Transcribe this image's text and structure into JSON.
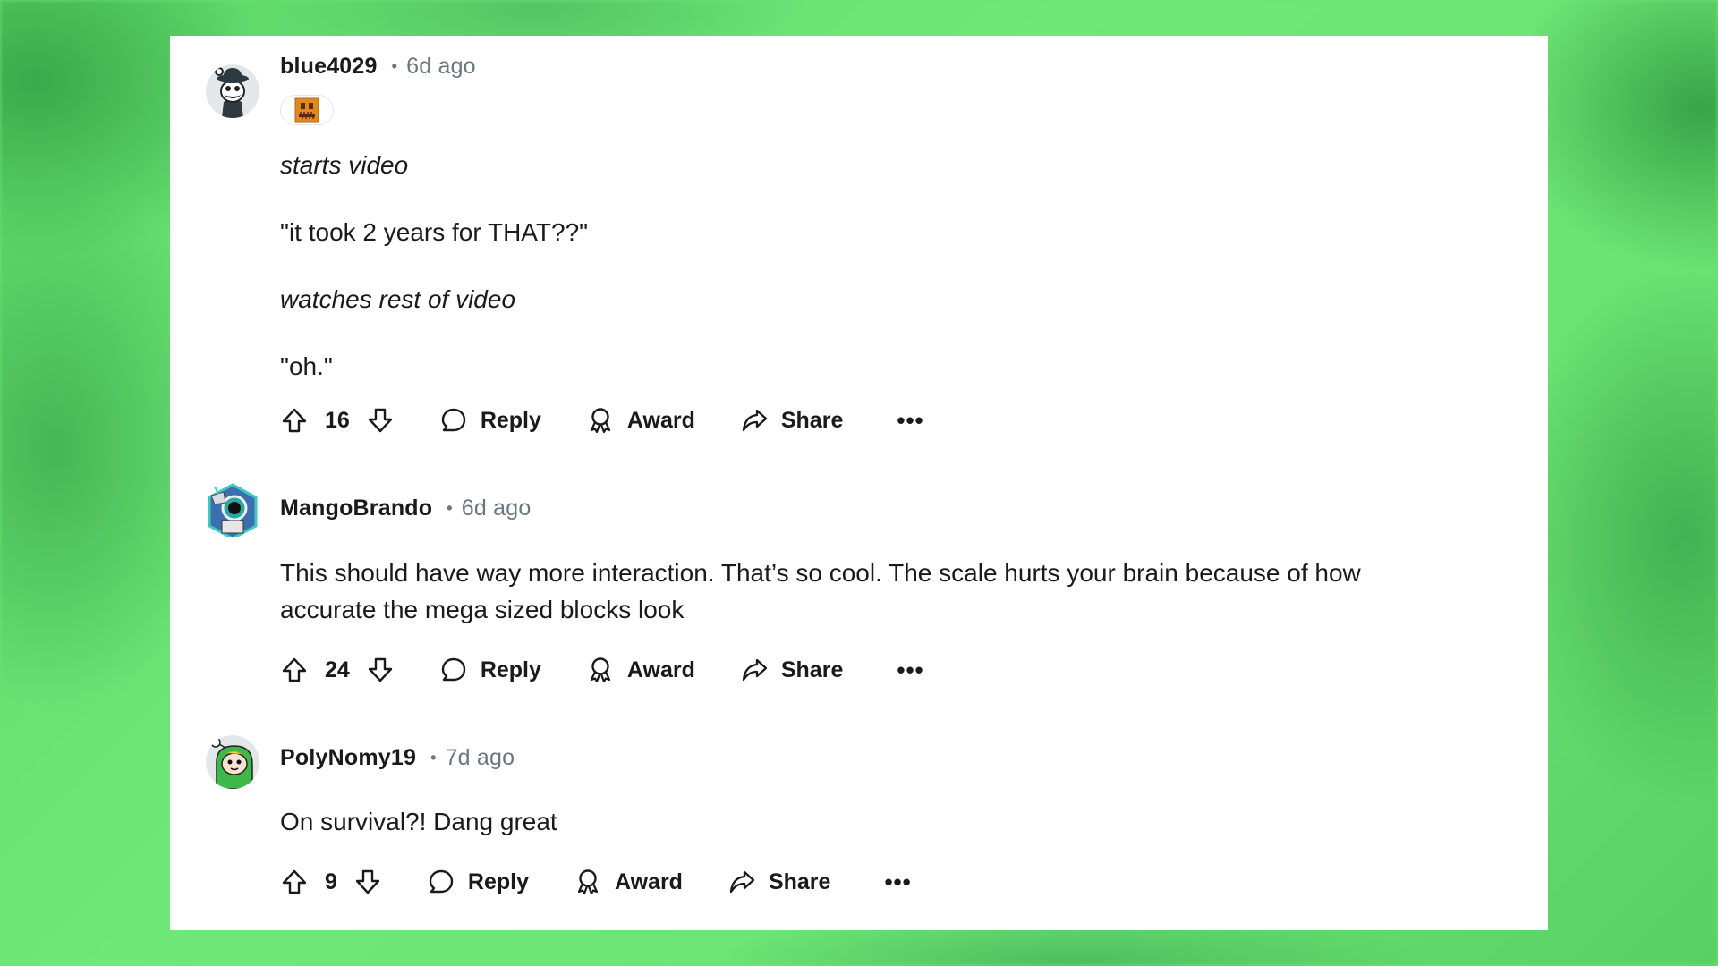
{
  "colors": {
    "background": "#6ce574",
    "card": "#ffffff",
    "text": "#1a1a1b",
    "meta": "#6b7780",
    "flair": "#e08a1e"
  },
  "comments": [
    {
      "username": "blue4029",
      "separator": "•",
      "timestamp": "6d ago",
      "avatar": "avatar-hat-character",
      "has_flair": true,
      "flair_icon": "orange-pumpkin-face-flair",
      "body": [
        {
          "text": "starts video",
          "italic": true
        },
        {
          "text": "\"it took 2 years for THAT??\"",
          "italic": false
        },
        {
          "text": "watches rest of video",
          "italic": true
        },
        {
          "text": "\"oh.\"",
          "italic": false
        }
      ],
      "score": "16",
      "actions": {
        "reply": "Reply",
        "award": "Award",
        "share": "Share",
        "more": "•••"
      }
    },
    {
      "username": "MangoBrando",
      "separator": "•",
      "timestamp": "6d ago",
      "avatar": "avatar-robot-hexagon",
      "body": [
        {
          "text": "This should have way more interaction. That’s so cool. The scale hurts your brain because of how",
          "italic": false
        },
        {
          "text": "accurate the mega sized blocks look",
          "italic": false
        }
      ],
      "score": "24",
      "actions": {
        "reply": "Reply",
        "award": "Award",
        "share": "Share",
        "more": "•••"
      }
    },
    {
      "username": "PolyNomy19",
      "separator": "•",
      "timestamp": "7d ago",
      "avatar": "avatar-green-hood-snoo",
      "body": [
        {
          "text": "On survival?! Dang great",
          "italic": false
        }
      ],
      "score": "9",
      "actions": {
        "reply": "Reply",
        "award": "Award",
        "share": "Share",
        "more": "•••"
      }
    }
  ]
}
